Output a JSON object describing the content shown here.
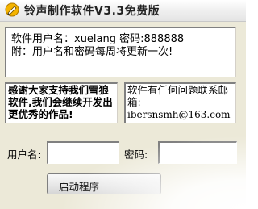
{
  "window": {
    "title": "铃声制作软件V3.3免费版",
    "icon": "pencil-icon"
  },
  "info": {
    "line1": "软件用户名：xuelang 密码:888888",
    "line2": "附：用户名和密码每周将更新一次!"
  },
  "thanks": {
    "text": "感谢大家支持我们雪狼软件,我们会继续开发出更优秀的作品!"
  },
  "contact": {
    "text": "软件有任何问题联系邮箱:",
    "email": "ibersnsmh@163.com"
  },
  "form": {
    "username_label": "用户名:",
    "username_value": "",
    "password_label": "密码:",
    "password_value": ""
  },
  "actions": {
    "start_label": "启动程序"
  }
}
